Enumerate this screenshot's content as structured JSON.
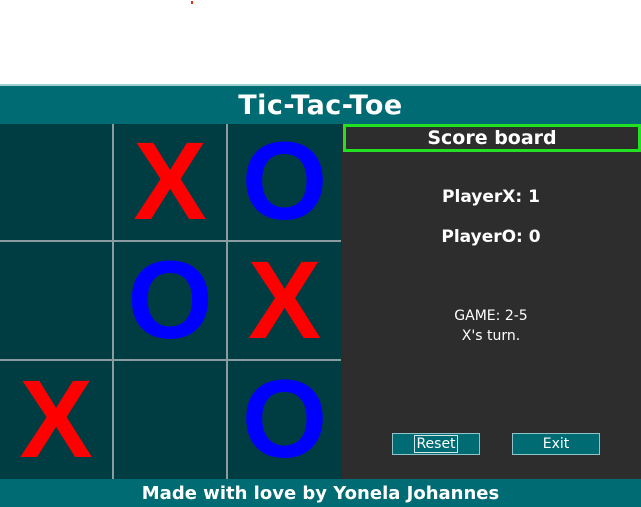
{
  "header": {
    "title": "Tic-Tac-Toe"
  },
  "board": {
    "cells": [
      "",
      "X",
      "O",
      "",
      "O",
      "X",
      "X",
      "",
      "O"
    ],
    "colors": {
      "X": "#ff0000",
      "O": "#0000ff"
    }
  },
  "scoreboard": {
    "title": "Score board",
    "player_x": "PlayerX: 1",
    "player_o": "PlayerO: 0",
    "game": "GAME: 2-5",
    "turn": "X's turn."
  },
  "buttons": {
    "reset": "Reset",
    "exit": "Exit"
  },
  "footer": {
    "text": "Made with love by Yonela Johannes"
  },
  "colors": {
    "accent": "#006b72",
    "cell_bg": "#003d42",
    "panel_bg": "#2d2d2d",
    "highlight": "#22e022"
  }
}
